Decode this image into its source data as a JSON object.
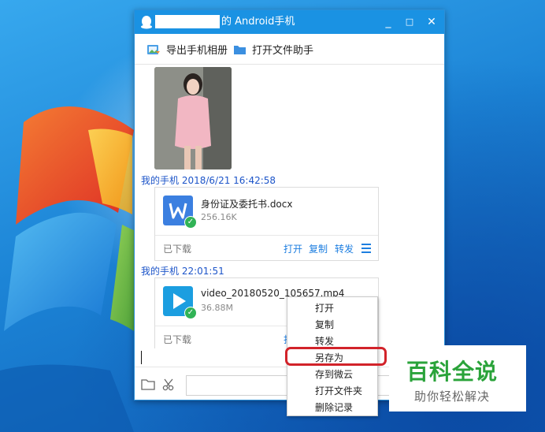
{
  "window": {
    "title_suffix": "的 Android手机",
    "minimize": "_",
    "maximize": "□",
    "close": "✕"
  },
  "toolbar": {
    "export_album": "导出手机相册",
    "open_file_helper": "打开文件助手"
  },
  "messages": [
    {
      "sender": "我的手机 2018/6/21 16:42:58",
      "file_name": "身份证及委托书.docx",
      "file_size": "256.16K",
      "status": "已下载",
      "actions": [
        "打开",
        "复制",
        "转发"
      ],
      "file_icon_color": "#3b7fe0"
    },
    {
      "sender": "我的手机  22:01:51",
      "file_name": "video_20180520_105657.mp4",
      "file_size": "36.88M",
      "status": "已下载",
      "actions": [
        "打"
      ],
      "file_icon_color": "#1b9ee0"
    }
  ],
  "context_menu": {
    "items": [
      "打开",
      "复制",
      "转发",
      "另存为",
      "存到微云",
      "打开文件夹",
      "删除记录"
    ],
    "highlighted": "另存为",
    "highlight_color": "#d2232a"
  },
  "watermark": {
    "title": "百科全说",
    "subtitle": "助你轻松解决"
  },
  "colors": {
    "titlebar": "#1a92e3",
    "link": "#1d7ee0",
    "sender": "#1d55c9"
  }
}
